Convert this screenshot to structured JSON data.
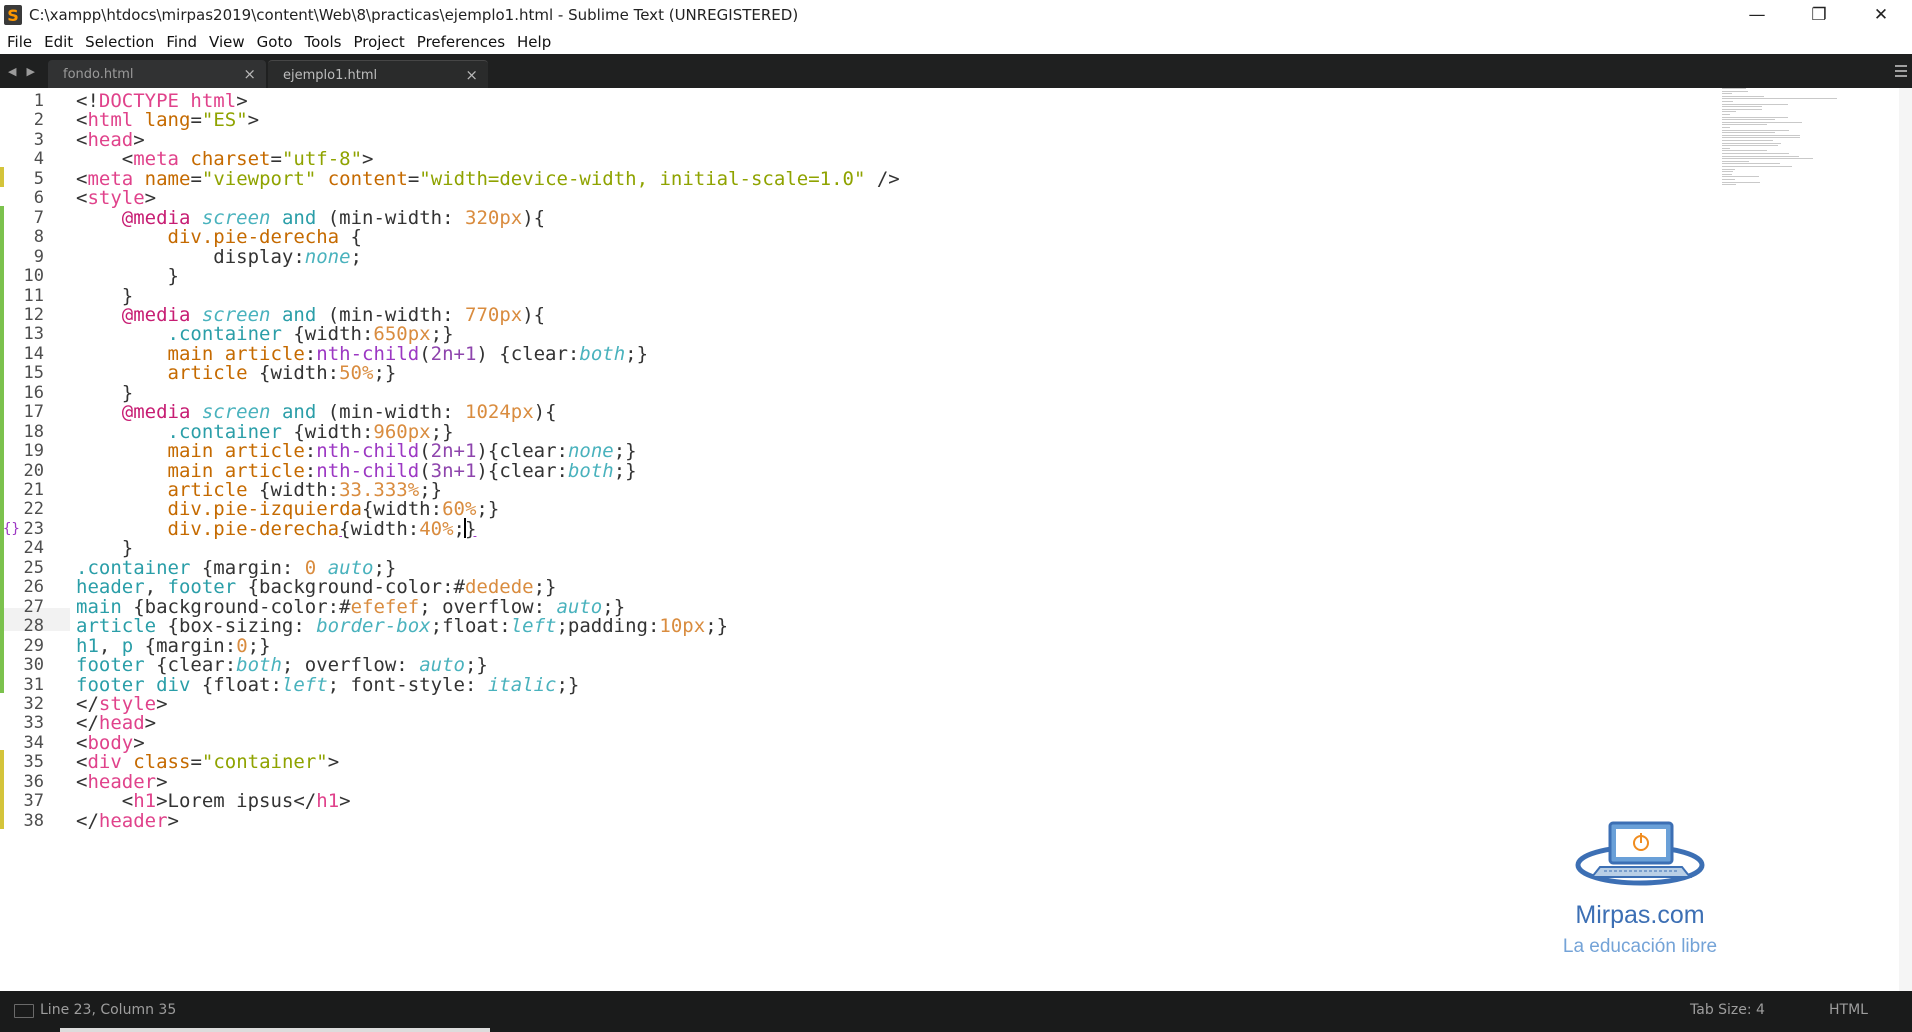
{
  "window": {
    "title": "C:\\xampp\\htdocs\\mirpas2019\\content\\Web\\8\\practicas\\ejemplo1.html - Sublime Text (UNREGISTERED)",
    "minimize": "—",
    "restore": "❐",
    "close": "✕"
  },
  "menu": [
    "File",
    "Edit",
    "Selection",
    "Find",
    "View",
    "Goto",
    "Tools",
    "Project",
    "Preferences",
    "Help"
  ],
  "tabs": [
    {
      "label": "fondo.html",
      "close": "×"
    },
    {
      "label": "ejemplo1.html",
      "close": "×",
      "active": true
    }
  ],
  "editor": {
    "line_numbers": [
      "1",
      "2",
      "3",
      "4",
      "5",
      "6",
      "7",
      "8",
      "9",
      "10",
      "11",
      "12",
      "13",
      "14",
      "15",
      "16",
      "17",
      "18",
      "19",
      "20",
      "21",
      "22",
      "23",
      "24",
      "25",
      "26",
      "27",
      "28",
      "29",
      "30",
      "31",
      "32",
      "33",
      "34",
      "35",
      "36",
      "37",
      "38"
    ],
    "bracket_indicator": "{}",
    "code": [
      [
        [
          "t",
          "<!"
        ],
        [
          "kw-tag",
          "DOCTYPE"
        ],
        [
          "pl",
          " "
        ],
        [
          "kw-tag",
          "html"
        ],
        [
          "t",
          ">"
        ]
      ],
      [
        [
          "t",
          "<"
        ],
        [
          "kw-tag",
          "html"
        ],
        [
          "pl",
          " "
        ],
        [
          "att",
          "lang"
        ],
        [
          "pl",
          "="
        ],
        [
          "str",
          "\"ES\""
        ],
        [
          "t",
          ">"
        ]
      ],
      [
        [
          "t",
          "<"
        ],
        [
          "kw-tag",
          "head"
        ],
        [
          "t",
          ">"
        ]
      ],
      [
        [
          "pl",
          "    <"
        ],
        [
          "kw-tag",
          "meta"
        ],
        [
          "pl",
          " "
        ],
        [
          "att",
          "charset"
        ],
        [
          "pl",
          "="
        ],
        [
          "str",
          "\"utf-8\""
        ],
        [
          "t",
          ">"
        ]
      ],
      [
        [
          "t",
          "<"
        ],
        [
          "kw-tag",
          "meta"
        ],
        [
          "pl",
          " "
        ],
        [
          "att",
          "name"
        ],
        [
          "pl",
          "="
        ],
        [
          "str",
          "\"viewport\""
        ],
        [
          "pl",
          " "
        ],
        [
          "att",
          "content"
        ],
        [
          "pl",
          "="
        ],
        [
          "str",
          "\"width=device-width, initial-scale=1.0\""
        ],
        [
          "pl",
          " />"
        ]
      ],
      [
        [
          "t",
          "<"
        ],
        [
          "kw-tag",
          "style"
        ],
        [
          "t",
          ">"
        ]
      ],
      [
        [
          "pl",
          "    "
        ],
        [
          "at",
          "@media"
        ],
        [
          "pl",
          " "
        ],
        [
          "it",
          "screen"
        ],
        [
          "pl",
          " "
        ],
        [
          "hl",
          "and"
        ],
        [
          "pl",
          " (min-width: "
        ],
        [
          "num",
          "320px"
        ],
        [
          "pl",
          "){"
        ]
      ],
      [
        [
          "pl",
          "        "
        ],
        [
          "cls",
          "div.pie-derecha"
        ],
        [
          "pl",
          " {"
        ]
      ],
      [
        [
          "pl",
          "            display:"
        ],
        [
          "it",
          "none"
        ],
        [
          "pl",
          ";"
        ]
      ],
      [
        [
          "pl",
          "        }"
        ]
      ],
      [
        [
          "pl",
          "    }"
        ]
      ],
      [
        [
          "pl",
          "    "
        ],
        [
          "at",
          "@media"
        ],
        [
          "pl",
          " "
        ],
        [
          "it",
          "screen"
        ],
        [
          "pl",
          " "
        ],
        [
          "hl",
          "and"
        ],
        [
          "pl",
          " (min-width: "
        ],
        [
          "num",
          "770px"
        ],
        [
          "pl",
          "){"
        ]
      ],
      [
        [
          "pl",
          "        "
        ],
        [
          "hl",
          ".container"
        ],
        [
          "pl",
          " {width:"
        ],
        [
          "num",
          "650px"
        ],
        [
          "pl",
          ";}"
        ]
      ],
      [
        [
          "pl",
          "        "
        ],
        [
          "cls",
          "main article"
        ],
        [
          "pl",
          ":"
        ],
        [
          "fn",
          "nth-child"
        ],
        [
          "pl",
          "("
        ],
        [
          "bl",
          "2n+1"
        ],
        [
          "pl",
          ") {clear:"
        ],
        [
          "it",
          "both"
        ],
        [
          "pl",
          ";}"
        ]
      ],
      [
        [
          "pl",
          "        "
        ],
        [
          "cls",
          "article"
        ],
        [
          "pl",
          " {width:"
        ],
        [
          "num",
          "50%"
        ],
        [
          "pl",
          ";}"
        ]
      ],
      [
        [
          "pl",
          "    }"
        ]
      ],
      [
        [
          "pl",
          "    "
        ],
        [
          "at",
          "@media"
        ],
        [
          "pl",
          " "
        ],
        [
          "it",
          "screen"
        ],
        [
          "pl",
          " "
        ],
        [
          "hl",
          "and"
        ],
        [
          "pl",
          " (min-width: "
        ],
        [
          "num",
          "1024px"
        ],
        [
          "pl",
          "){"
        ]
      ],
      [
        [
          "pl",
          "        "
        ],
        [
          "hl",
          ".container"
        ],
        [
          "pl",
          " {width:"
        ],
        [
          "num",
          "960px"
        ],
        [
          "pl",
          ";}"
        ]
      ],
      [
        [
          "pl",
          "        "
        ],
        [
          "cls",
          "main article"
        ],
        [
          "pl",
          ":"
        ],
        [
          "fn",
          "nth-child"
        ],
        [
          "pl",
          "("
        ],
        [
          "bl",
          "2n+1"
        ],
        [
          "pl",
          ")"
        ],
        [
          "pl",
          "{clear:"
        ],
        [
          "it",
          "none"
        ],
        [
          "pl",
          ";}"
        ]
      ],
      [
        [
          "pl",
          "        "
        ],
        [
          "cls",
          "main article"
        ],
        [
          "pl",
          ":"
        ],
        [
          "fn",
          "nth-child"
        ],
        [
          "pl",
          "("
        ],
        [
          "bl",
          "3n+1"
        ],
        [
          "pl",
          ")"
        ],
        [
          "pl",
          "{clear:"
        ],
        [
          "it",
          "both"
        ],
        [
          "pl",
          ";}"
        ]
      ],
      [
        [
          "pl",
          "        "
        ],
        [
          "cls",
          "article"
        ],
        [
          "pl",
          " {width:"
        ],
        [
          "num",
          "33.333%"
        ],
        [
          "pl",
          ";}"
        ]
      ],
      [
        [
          "pl",
          "        "
        ],
        [
          "cls",
          "div.pie-izquierda"
        ],
        [
          "pl",
          "{width:"
        ],
        [
          "num",
          "60%"
        ],
        [
          "pl",
          ";}"
        ]
      ],
      [
        [
          "pl",
          "        "
        ],
        [
          "cls",
          "div.pie-derecha"
        ],
        [
          "ul",
          "{"
        ],
        [
          "pl",
          "width:"
        ],
        [
          "num",
          "40%"
        ],
        [
          "pl",
          ";"
        ],
        [
          "cursor",
          ""
        ],
        [
          "ul",
          "}"
        ]
      ],
      [
        [
          "pl",
          "    }"
        ]
      ],
      [
        [
          "hl",
          ".container"
        ],
        [
          "pl",
          " {margin: "
        ],
        [
          "num",
          "0"
        ],
        [
          "pl",
          " "
        ],
        [
          "it",
          "auto"
        ],
        [
          "pl",
          ";}"
        ]
      ],
      [
        [
          "hl",
          "header"
        ],
        [
          "pl",
          ", "
        ],
        [
          "hl",
          "footer"
        ],
        [
          "pl",
          " {background-color:"
        ],
        [
          "pl",
          "#"
        ],
        [
          "num",
          "dedede"
        ],
        [
          "pl",
          ";}"
        ]
      ],
      [
        [
          "hl",
          "main"
        ],
        [
          "pl",
          " {background-color:"
        ],
        [
          "pl",
          "#"
        ],
        [
          "num",
          "efefef"
        ],
        [
          "pl",
          "; overflow: "
        ],
        [
          "it",
          "auto"
        ],
        [
          "pl",
          ";}"
        ]
      ],
      [
        [
          "hl",
          "article"
        ],
        [
          "pl",
          " {box-sizing: "
        ],
        [
          "it",
          "border-box"
        ],
        [
          "pl",
          ";float:"
        ],
        [
          "it",
          "left"
        ],
        [
          "pl",
          ";padding:"
        ],
        [
          "num",
          "10px"
        ],
        [
          "pl",
          ";}"
        ]
      ],
      [
        [
          "hl",
          "h1"
        ],
        [
          "pl",
          ", "
        ],
        [
          "hl",
          "p"
        ],
        [
          "pl",
          " {margin:"
        ],
        [
          "num",
          "0"
        ],
        [
          "pl",
          ";}"
        ]
      ],
      [
        [
          "hl",
          "footer"
        ],
        [
          "pl",
          " {clear:"
        ],
        [
          "it",
          "both"
        ],
        [
          "pl",
          "; overflow: "
        ],
        [
          "it",
          "auto"
        ],
        [
          "pl",
          ";}"
        ]
      ],
      [
        [
          "hl",
          "footer div"
        ],
        [
          "pl",
          " {float:"
        ],
        [
          "it",
          "left"
        ],
        [
          "pl",
          "; font-style: "
        ],
        [
          "it",
          "italic"
        ],
        [
          "pl",
          ";}"
        ]
      ],
      [
        [
          "t",
          "</"
        ],
        [
          "kw-tag",
          "style"
        ],
        [
          "t",
          ">"
        ]
      ],
      [
        [
          "t",
          "</"
        ],
        [
          "kw-tag",
          "head"
        ],
        [
          "t",
          ">"
        ]
      ],
      [
        [
          "t",
          "<"
        ],
        [
          "kw-tag",
          "body"
        ],
        [
          "t",
          ">"
        ]
      ],
      [
        [
          "t",
          "<"
        ],
        [
          "kw-tag",
          "div"
        ],
        [
          "pl",
          " "
        ],
        [
          "att",
          "class"
        ],
        [
          "pl",
          "="
        ],
        [
          "str",
          "\"container\""
        ],
        [
          "t",
          ">"
        ]
      ],
      [
        [
          "t",
          "<"
        ],
        [
          "kw-tag",
          "header"
        ],
        [
          "t",
          ">"
        ]
      ],
      [
        [
          "pl",
          "    <"
        ],
        [
          "kw-tag",
          "h1"
        ],
        [
          "pl",
          ">Lorem ipsus</"
        ],
        [
          "kw-tag",
          "h1"
        ],
        [
          "t",
          ">"
        ]
      ],
      [
        [
          "t",
          "</"
        ],
        [
          "kw-tag",
          "header"
        ],
        [
          "t",
          ">"
        ]
      ]
    ]
  },
  "watermark": {
    "title": "Mirpas.com",
    "subtitle": "La educación libre",
    "icon": "laptop-power-icon"
  },
  "status": {
    "position": "Line 23, Column 35",
    "tab_size": "Tab Size: 4",
    "syntax": "HTML"
  },
  "colors": {
    "tag": "#e0428b",
    "string": "#8fa300",
    "attribute": "#c56a00",
    "number": "#d98c3f",
    "keyword": "#2a9ea8",
    "at_rule": "#c71d73",
    "status_bg": "#1a1b1b",
    "tabbar_bg": "#1f2020"
  }
}
